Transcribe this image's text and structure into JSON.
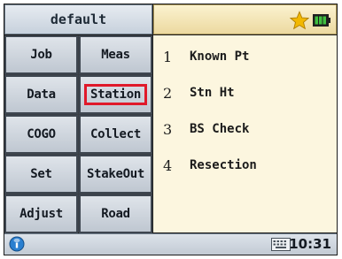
{
  "title_bar": {
    "title": "default"
  },
  "status_bar": {
    "icons": [
      "star-icon",
      "battery-icon"
    ]
  },
  "menu": {
    "buttons": [
      {
        "label": "Job"
      },
      {
        "label": "Meas"
      },
      {
        "label": "Data"
      },
      {
        "label": "Station",
        "selected": true
      },
      {
        "label": "COGO"
      },
      {
        "label": "Collect"
      },
      {
        "label": "Set"
      },
      {
        "label": "StakeOut"
      },
      {
        "label": "Adjust"
      },
      {
        "label": "Road"
      }
    ]
  },
  "content": {
    "items": [
      {
        "num": "1",
        "label": "Known Pt"
      },
      {
        "num": "2",
        "label": "Stn Ht"
      },
      {
        "num": "3",
        "label": "BS Check"
      },
      {
        "num": "4",
        "label": "Resection"
      }
    ]
  },
  "bottom_bar": {
    "time": "10:31",
    "icons": [
      "info-icon",
      "keyboard-icon"
    ]
  },
  "colors": {
    "selection_border": "#e0192a",
    "star": "#f2b800",
    "battery": "#2e9b2e",
    "list_background": "#fcf6df"
  }
}
